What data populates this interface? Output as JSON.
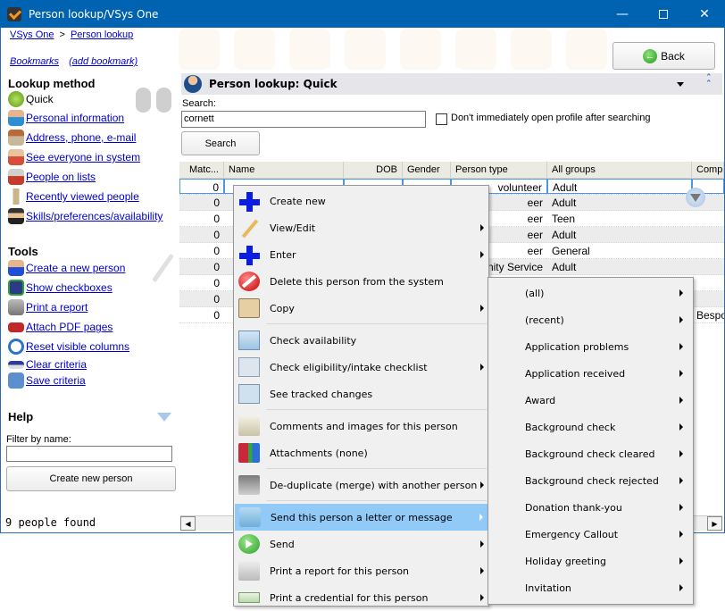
{
  "window": {
    "title": "Person lookup/VSys One",
    "minimize_icon": "minimize-icon",
    "maximize_icon": "maximize-icon",
    "close_icon": "close-icon"
  },
  "breadcrumb": {
    "items": [
      "VSys One",
      "Person lookup"
    ],
    "separator": ">"
  },
  "bookmarks": {
    "label": "Bookmarks",
    "add_label": "(add bookmark)"
  },
  "back_button": {
    "label": "Back",
    "icon": "back-arrow-icon"
  },
  "sidebar": {
    "lookup_heading": "Lookup method",
    "lookup_items": [
      {
        "label": "Quick",
        "icon": "lightning-icon",
        "active": true
      },
      {
        "label": "Personal information",
        "icon": "person-icon"
      },
      {
        "label": "Address, phone, e-mail",
        "icon": "house-icon"
      },
      {
        "label": "See everyone in system",
        "icon": "group-icon"
      },
      {
        "label": "People on lists",
        "icon": "people-list-icon"
      },
      {
        "label": "Recently viewed people",
        "icon": "hourglass-icon"
      },
      {
        "label": "Skills/preferences/availability",
        "icon": "graduate-icon"
      }
    ],
    "tools_heading": "Tools",
    "tool_items": [
      {
        "label": "Create a new person",
        "icon": "add-person-icon"
      },
      {
        "label": "Show checkboxes",
        "icon": "checkbox-icon"
      },
      {
        "label": "Print a report",
        "icon": "printer-icon"
      },
      {
        "label": "Attach PDF pages",
        "icon": "pdf-icon"
      },
      {
        "label": "Reset visible columns",
        "icon": "reset-icon"
      },
      {
        "label": "Clear criteria",
        "icon": "eraser-icon"
      },
      {
        "label": "Save criteria",
        "icon": "floppy-icon"
      }
    ],
    "help_heading": "Help",
    "filter_label": "Filter by name:",
    "filter_value": "",
    "create_button": "Create new person",
    "found_text": "9 people found"
  },
  "panel": {
    "title": "Person lookup: Quick",
    "search_label": "Search:",
    "search_value": "cornett",
    "checkbox_label": "Don't immediately open profile after searching",
    "checkbox_checked": false,
    "search_button": "Search"
  },
  "grid": {
    "columns": [
      "Matc...",
      "Name",
      "DOB",
      "Gender",
      "Person type",
      "All groups",
      "Comp"
    ],
    "rows": [
      {
        "match": "0",
        "person_type": "volunteer",
        "groups": "Adult",
        "company": ""
      },
      {
        "match": "0",
        "person_type": "eer",
        "groups": "Adult",
        "company": ""
      },
      {
        "match": "0",
        "person_type": "eer",
        "groups": "Teen",
        "company": ""
      },
      {
        "match": "0",
        "person_type": "eer",
        "groups": "Adult",
        "company": ""
      },
      {
        "match": "0",
        "person_type": "eer",
        "groups": "General",
        "company": ""
      },
      {
        "match": "0",
        "person_type": "unity Service",
        "groups": "Adult",
        "company": ""
      },
      {
        "match": "0",
        "person_type": "",
        "groups": "",
        "company": ""
      },
      {
        "match": "0",
        "person_type": "",
        "groups": "",
        "company": ""
      },
      {
        "match": "0",
        "person_type": "",
        "groups": "",
        "company": "Bespo"
      }
    ]
  },
  "context_menu": {
    "items": [
      {
        "label": "Create new",
        "icon": "plus-icon",
        "submenu": false
      },
      {
        "label": "View/Edit",
        "icon": "pencil-icon",
        "submenu": true
      },
      {
        "label": "Enter",
        "icon": "plus-icon",
        "submenu": true
      },
      {
        "label": "Delete this person from the system",
        "icon": "no-entry-icon",
        "submenu": false
      },
      {
        "label": "Copy",
        "icon": "clipboard-icon",
        "submenu": true
      },
      {
        "separator": true
      },
      {
        "label": "Check availability",
        "icon": "calendar-icon",
        "submenu": false
      },
      {
        "label": "Check eligibility/intake checklist",
        "icon": "checklist-icon",
        "submenu": true
      },
      {
        "label": "See tracked changes",
        "icon": "magnifier-icon",
        "submenu": false
      },
      {
        "separator": true
      },
      {
        "label": "Comments and images for this person",
        "icon": "notebook-icon",
        "submenu": false
      },
      {
        "label": "Attachments (none)",
        "icon": "attachments-icon",
        "submenu": false
      },
      {
        "separator": true
      },
      {
        "label": "De-duplicate (merge) with another person",
        "icon": "stapler-icon",
        "submenu": true
      },
      {
        "separator": true
      },
      {
        "label": "Send this person a letter or message",
        "icon": "envelope-icon",
        "submenu": true,
        "highlighted": true
      },
      {
        "label": "Send",
        "icon": "green-arrow-icon",
        "submenu": true
      },
      {
        "label": "Print a report for this person",
        "icon": "report-icon",
        "submenu": true
      },
      {
        "label": "Print a credential for this person",
        "icon": "credential-icon",
        "submenu": true
      }
    ]
  },
  "submenu": {
    "items": [
      "(all)",
      "(recent)",
      "Application problems",
      "Application received",
      "Award",
      "Background check",
      "Background check cleared",
      "Background check rejected",
      "Donation thank-you",
      "Emergency Callout",
      "Holiday greeting",
      "Invitation"
    ]
  }
}
